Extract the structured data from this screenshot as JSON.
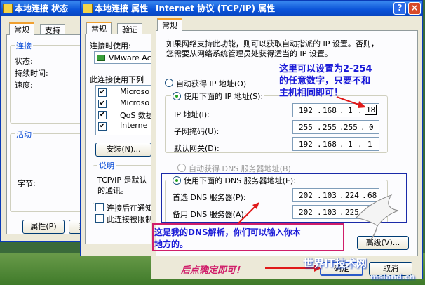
{
  "window1": {
    "title": "本地连接 状态",
    "tabs": [
      "常规",
      "支持"
    ],
    "group_connect": "连接",
    "rows": [
      "状态:",
      "持续时间:",
      "速度:"
    ],
    "group_activity": "活动",
    "bytes_label": "字节:",
    "btn_properties": "属性(P)",
    "btn_disable": "禁"
  },
  "window2": {
    "title": "本地连接 属性",
    "tabs": [
      "常规",
      "验证"
    ],
    "connect_using": "连接时使用:",
    "adapter": "VMware Ac",
    "items_label": "此连接使用下列",
    "items": [
      "Microso",
      "Microso",
      "QoS 数据",
      "Interne"
    ],
    "btn_install": "安装(N)...",
    "group_desc": "说明",
    "desc_line1": "TCP/IP 是默认",
    "desc_line2": "的通讯。",
    "chk_notify": "连接后在通知",
    "chk_limited": "此连接被限制"
  },
  "dialog": {
    "title": "Internet 协议 (TCP/IP) 属性",
    "tab": "常规",
    "intro_line1": "如果网络支持此功能，则可以获取自动指派的 IP 设置。否则，",
    "intro_line2": "您需要从网络系统管理员处获得适当的 IP 设置。",
    "auto_ip": "自动获得 IP 地址(O)",
    "manual_ip": "使用下面的 IP 地址(S):",
    "ip_label": "IP 地址(I):",
    "mask_label": "子网掩码(U):",
    "gateway_label": "默认网关(D):",
    "ip": [
      "192",
      "168",
      "1",
      "18"
    ],
    "mask": [
      "255",
      "255",
      "255",
      "0"
    ],
    "gateway": [
      "192",
      "168",
      "1",
      "1"
    ],
    "auto_dns": "自动获得 DNS 服务器地址(B)",
    "manual_dns": "使用下面的 DNS 服务器地址(E):",
    "pref_dns_label": "首选 DNS 服务器(P):",
    "alt_dns_label": "备用 DNS 服务器(A):",
    "pref_dns": [
      "202",
      "103",
      "224",
      "68"
    ],
    "alt_dns": [
      "202",
      "103",
      "225",
      "68"
    ],
    "btn_advanced": "高级(V)...",
    "btn_ok": "确定",
    "btn_cancel": "取消"
  },
  "annotations": {
    "note_ip_1": "这里可以设置为2-254",
    "note_ip_2": "的任意数字，只要不和",
    "note_ip_3": "主机相同即可！",
    "note_dns_1": "这是我的DNS解析，你们可以输入你本",
    "note_dns_2": "地方的。",
    "note_ok": "后点确定即可！"
  },
  "watermark": {
    "main": "世界IT技术网",
    "site": "msland.cn"
  },
  "colors": {
    "accent": "#0a52d8",
    "annotation_text": "#1a1ad8",
    "annotation_box": "#d01e6a",
    "dns_box": "#1a2aa8"
  }
}
